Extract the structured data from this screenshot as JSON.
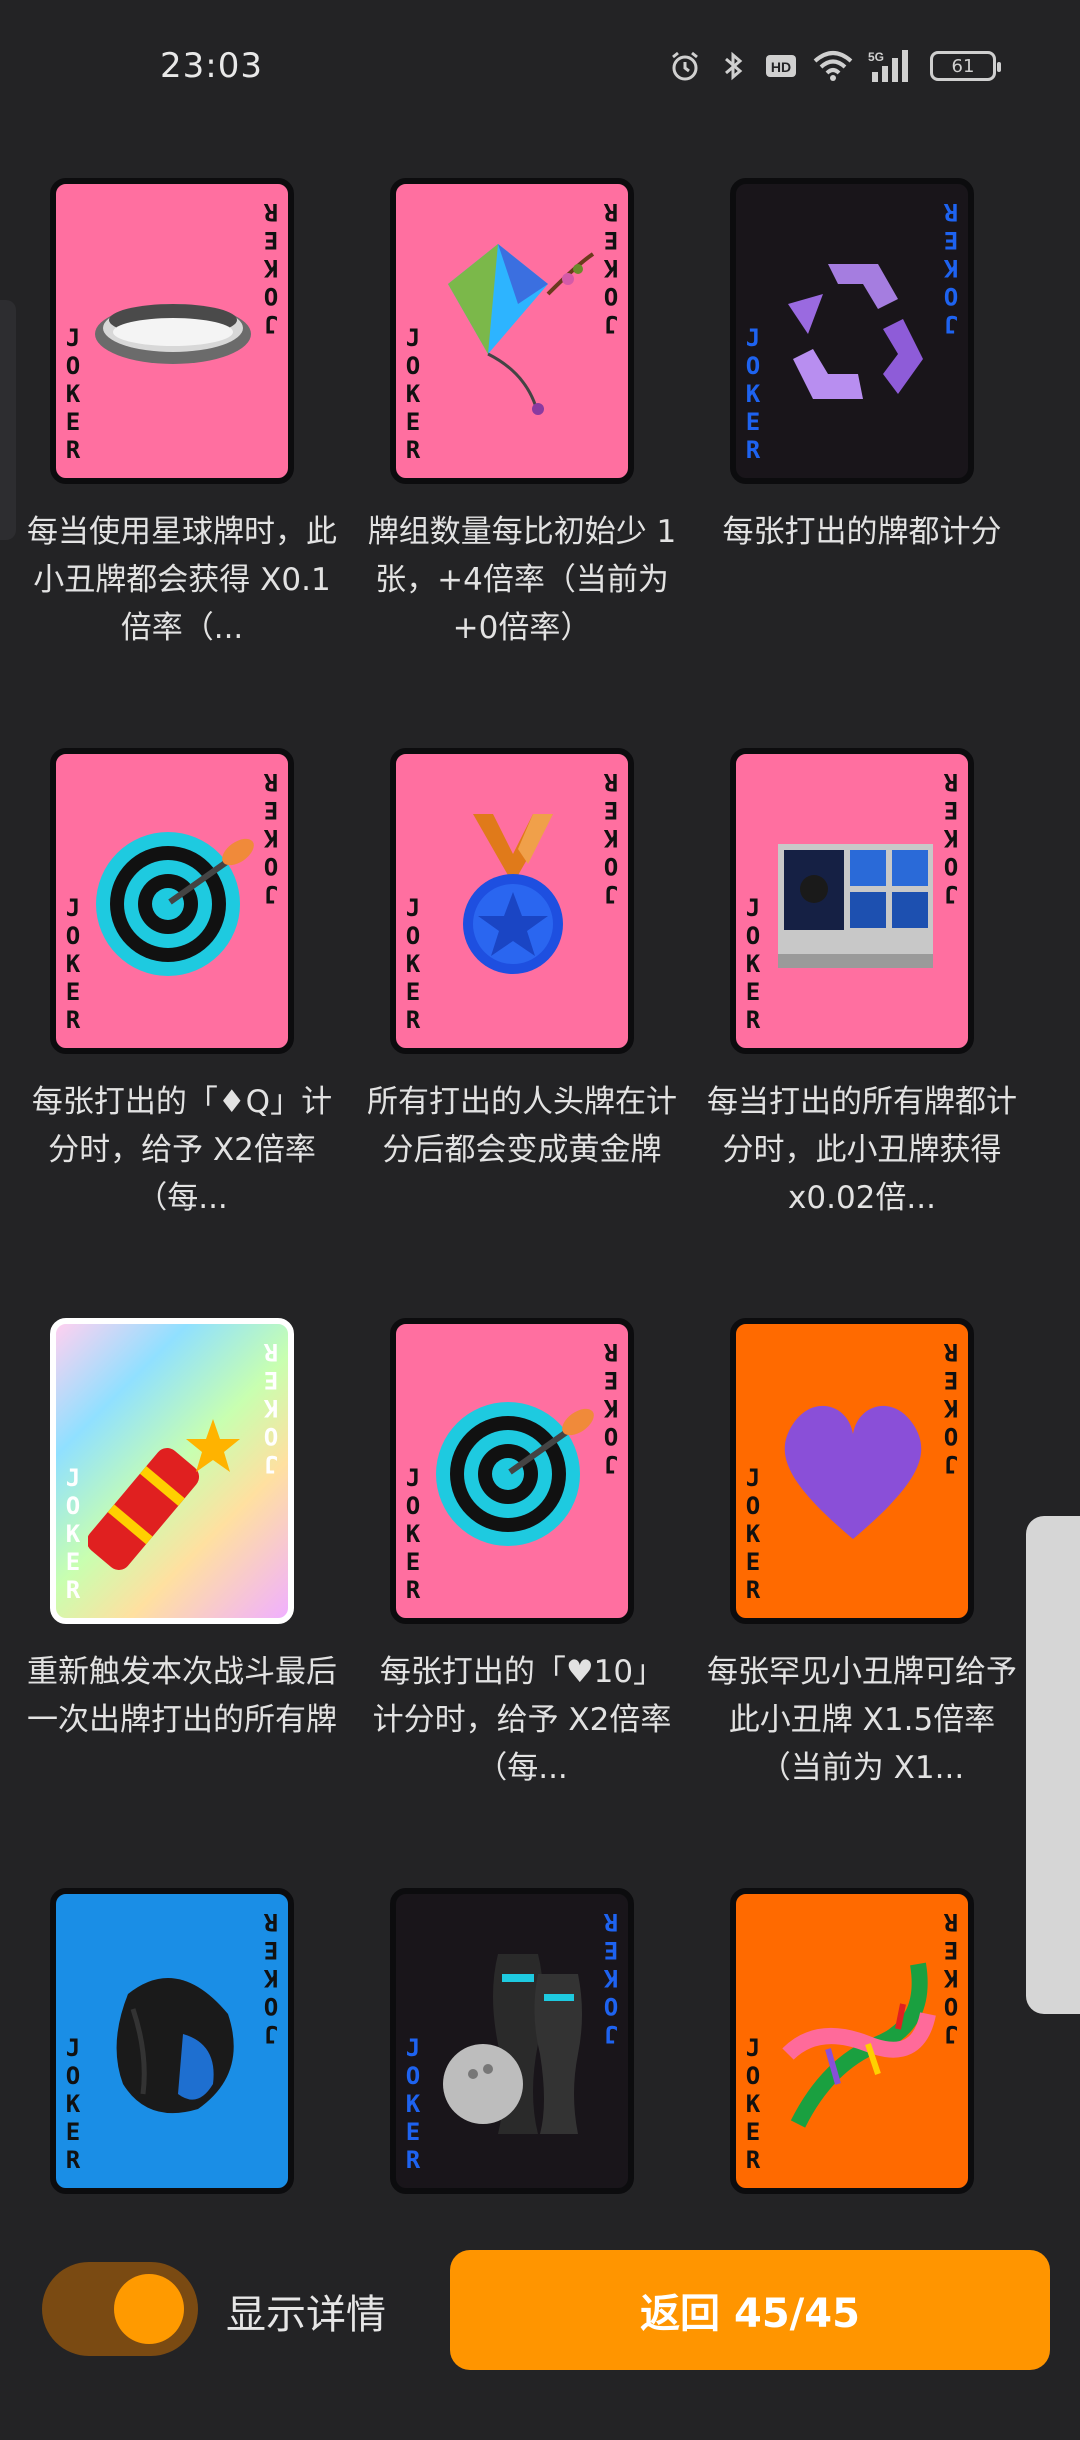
{
  "status_bar": {
    "time": "23:03",
    "battery": "61"
  },
  "cards": [
    {
      "desc": "每当使用星球牌时，此小丑牌都会获得 X0.1倍率（...",
      "bg": "#ff6fa0",
      "joker_color": "#111111",
      "icon": "hole-icon"
    },
    {
      "desc": "牌组数量每比初始少 1 张，+4倍率（当前为 +0倍率）",
      "bg": "#ff6fa0",
      "joker_color": "#111111",
      "icon": "kite-icon"
    },
    {
      "desc": "每张打出的牌都计分",
      "bg": "#19151a",
      "joker_color": "#1e63f0",
      "icon": "recycle-icon"
    },
    {
      "desc": "每张打出的「♦Q」计分时，给予 X2倍率（每...",
      "bg": "#ff6fa0",
      "joker_color": "#111111",
      "icon": "target-icon"
    },
    {
      "desc": "所有打出的人头牌在计分后都会变成黄金牌",
      "bg": "#ff6fa0",
      "joker_color": "#111111",
      "icon": "medal-icon"
    },
    {
      "desc": "每当打出的所有牌都计分时，此小丑牌获得 x0.02倍...",
      "bg": "#ff6fa0",
      "joker_color": "#111111",
      "icon": "collection-box-icon"
    },
    {
      "desc": "重新触发本次战斗最后一次出牌打出的所有牌",
      "bg": "rainbow",
      "joker_color": "#ffffff",
      "icon": "firecracker-icon"
    },
    {
      "desc": "每张打出的「♥10」计分时，给予 X2倍率（每...",
      "bg": "#ff6fa0",
      "joker_color": "#111111",
      "icon": "target-icon"
    },
    {
      "desc": "每张罕见小丑牌可给予此小丑牌 X1.5倍率（当前为 X1...",
      "bg": "#ff6a00",
      "joker_color": "#111111",
      "icon": "purple-heart-icon"
    },
    {
      "desc": "",
      "bg": "#1a8ee6",
      "joker_color": "#111111",
      "icon": "shell-icon"
    },
    {
      "desc": "",
      "bg": "#19151a",
      "joker_color": "#1e63f0",
      "icon": "bowling-icon"
    },
    {
      "desc": "",
      "bg": "#ff6a00",
      "joker_color": "#111111",
      "icon": "dna-icon"
    }
  ],
  "joker_word": "JOKER",
  "bottom": {
    "toggle_label": "显示详情",
    "return_label": "返回 45/45"
  }
}
